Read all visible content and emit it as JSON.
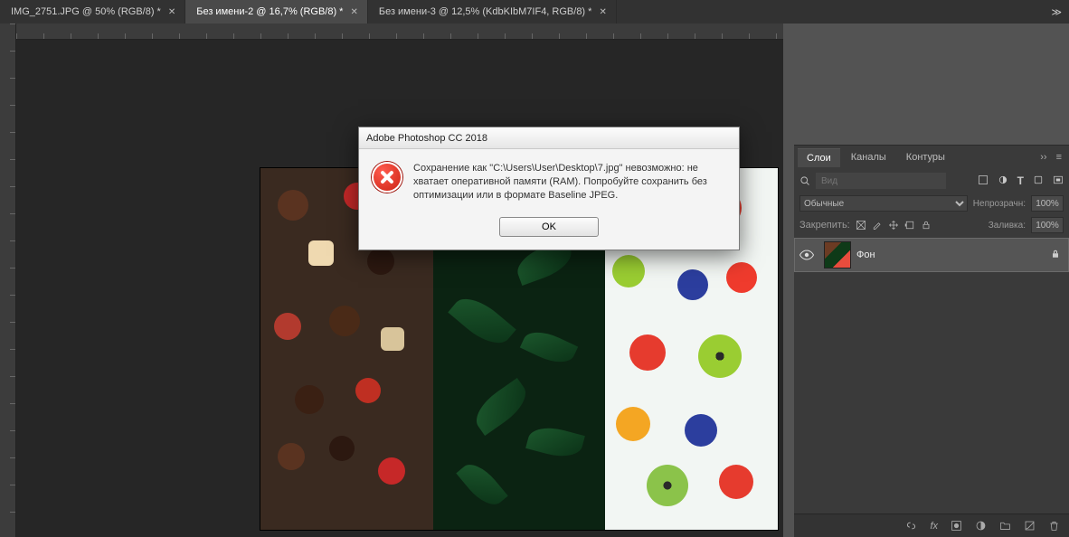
{
  "tabs": [
    {
      "label": "IMG_2751.JPG @ 50% (RGB/8) *",
      "active": false
    },
    {
      "label": "Без имени-2 @ 16,7% (RGB/8) *",
      "active": true
    },
    {
      "label": "Без имени-3 @ 12,5% (KdbKIbM7IF4, RGB/8) *",
      "active": false
    }
  ],
  "dialog": {
    "title": "Adobe Photoshop CC 2018",
    "message": "Сохранение как \"C:\\Users\\User\\Desktop\\7.jpg\" невозможно: не хватает оперативной памяти (RAM). Попробуйте сохранить без оптимизации или в формате Baseline JPEG.",
    "ok_label": "OK"
  },
  "layers_panel": {
    "tabs": {
      "layers": "Слои",
      "channels": "Каналы",
      "paths": "Контуры"
    },
    "search_placeholder": "Вид",
    "blend_mode": "Обычные",
    "opacity_label": "Непрозрачн:",
    "opacity_value": "100%",
    "lock_label": "Закрепить:",
    "fill_label": "Заливка:",
    "fill_value": "100%",
    "layer_name": "Фон",
    "footer_fx": "fx"
  }
}
